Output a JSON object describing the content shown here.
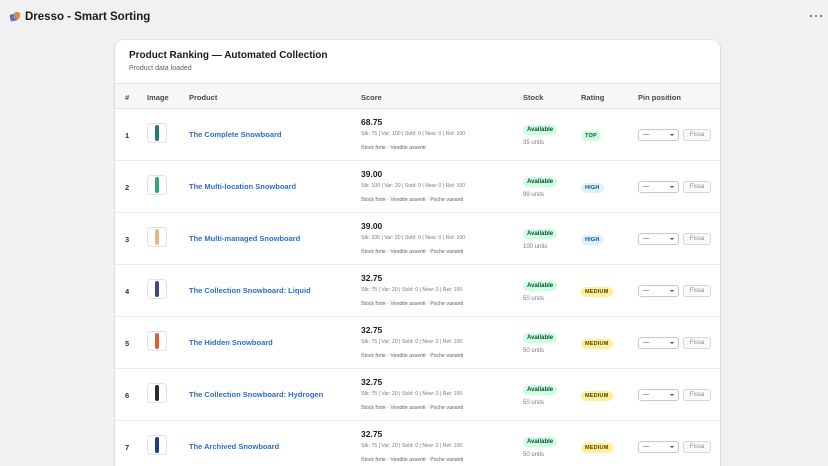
{
  "app": {
    "title": "Dresso - Smart Sorting",
    "icon": "tag-icon",
    "menu_icon": "more-horizontal-icon"
  },
  "card": {
    "title": "Product Ranking — Automated Collection",
    "subtitle": "Product data loaded",
    "columns": [
      "#",
      "Image",
      "Product",
      "Score",
      "Stock",
      "Rating",
      "Pin position"
    ]
  },
  "rating_colors": {
    "TOP": {
      "bg": "#cdfee1",
      "fg": "#0c5132"
    },
    "HIGH": {
      "bg": "#e0f0ff",
      "fg": "#00527c"
    },
    "MEDIUM": {
      "bg": "#ffef9d",
      "fg": "#4f4700"
    }
  },
  "rows": [
    {
      "rank": "1",
      "name": "The Complete Snowboard",
      "score": "68.75",
      "metrics": "Stk: 75 | Var: 100 | Sold: 0 | New: 0 | Ret: 100",
      "tags": "Stock forte · Vendite assenti",
      "stock": "Available",
      "units": "35 units",
      "rating": "TOP",
      "pin": "—",
      "fix": "Fissa",
      "board_color": "#2a7a6f"
    },
    {
      "rank": "2",
      "name": "The Multi-location Snowboard",
      "score": "39.00",
      "metrics": "Stk: 100 | Var: 20 | Sold: 0 | New: 0 | Ret: 100",
      "tags": "Stock forte · Vendite assenti · Poche varianti",
      "stock": "Available",
      "units": "99 units",
      "rating": "HIGH",
      "pin": "—",
      "fix": "Fissa",
      "board_color": "#2fa57a"
    },
    {
      "rank": "3",
      "name": "The Multi-managed Snowboard",
      "score": "39.00",
      "metrics": "Stk: 100 | Var: 20 | Sold: 0 | New: 0 | Ret: 100",
      "tags": "Stock forte · Vendite assenti · Poche varianti",
      "stock": "Available",
      "units": "100 units",
      "rating": "HIGH",
      "pin": "—",
      "fix": "Fissa",
      "board_color": "#e3b98a"
    },
    {
      "rank": "4",
      "name": "The Collection Snowboard: Liquid",
      "score": "32.75",
      "metrics": "Stk: 75 | Var: 20 | Sold: 0 | New: 0 | Ret: 100",
      "tags": "Stock forte · Vendite assenti · Poche varianti",
      "stock": "Available",
      "units": "50 units",
      "rating": "MEDIUM",
      "pin": "—",
      "fix": "Fissa",
      "board_color": "#3b4a7a"
    },
    {
      "rank": "5",
      "name": "The Hidden Snowboard",
      "score": "32.75",
      "metrics": "Stk: 75 | Var: 20 | Sold: 0 | New: 0 | Ret: 100",
      "tags": "Stock forte · Vendite assenti · Poche varianti",
      "stock": "Available",
      "units": "50 units",
      "rating": "MEDIUM",
      "pin": "—",
      "fix": "Fissa",
      "board_color": "#d9603a"
    },
    {
      "rank": "6",
      "name": "The Collection Snowboard: Hydrogen",
      "score": "32.75",
      "metrics": "Stk: 75 | Var: 20 | Sold: 0 | New: 0 | Ret: 100",
      "tags": "Stock forte · Vendite assenti · Poche varianti",
      "stock": "Available",
      "units": "50 units",
      "rating": "MEDIUM",
      "pin": "—",
      "fix": "Fissa",
      "board_color": "#2b2b2b"
    },
    {
      "rank": "7",
      "name": "The Archived Snowboard",
      "score": "32.75",
      "metrics": "Stk: 75 | Var: 20 | Sold: 0 | New: 0 | Ret: 100",
      "tags": "Stock forte · Vendite assenti · Poche varianti",
      "stock": "Available",
      "units": "50 units",
      "rating": "MEDIUM",
      "pin": "—",
      "fix": "Fissa",
      "board_color": "#1e3f7a"
    }
  ]
}
